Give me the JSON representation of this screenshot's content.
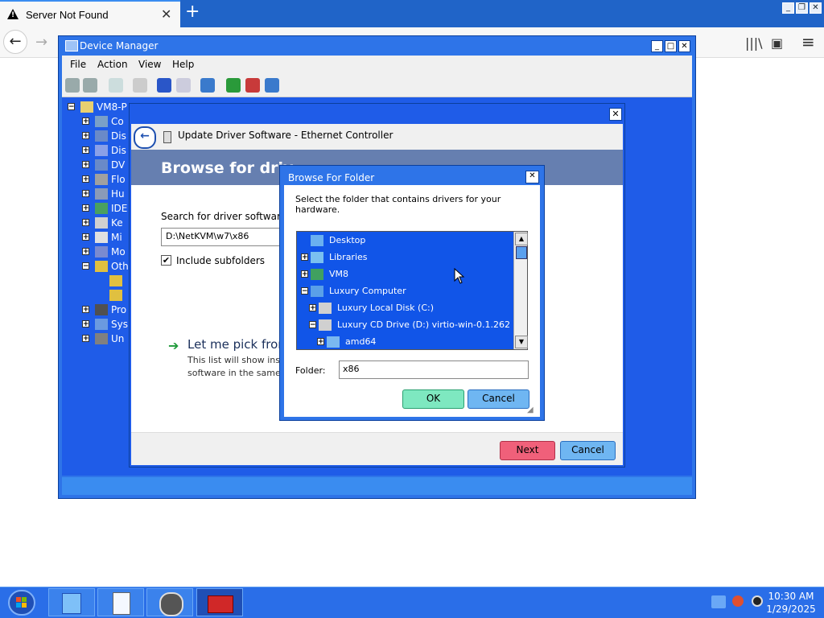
{
  "browser": {
    "tab_title": "Server Not Found",
    "tab_close": "✕",
    "new_tab": "+",
    "back": "←",
    "forward": "→",
    "library_icon": "|||\\",
    "sidebar_icon": "▣",
    "menu_icon": "≡",
    "win_min": "_",
    "win_max": "❐",
    "win_close": "✕"
  },
  "device_manager": {
    "title": "Device Manager",
    "menu": [
      "File",
      "Action",
      "View",
      "Help"
    ],
    "tree": [
      {
        "expander": "−",
        "label": "VM8-P",
        "level": 0
      },
      {
        "expander": "+",
        "label": "Co",
        "level": 1
      },
      {
        "expander": "+",
        "label": "Dis",
        "level": 1
      },
      {
        "expander": "+",
        "label": "Dis",
        "level": 1
      },
      {
        "expander": "+",
        "label": "DV",
        "level": 1
      },
      {
        "expander": "+",
        "label": "Flo",
        "level": 1
      },
      {
        "expander": "+",
        "label": "Hu",
        "level": 1
      },
      {
        "expander": "+",
        "label": "IDE",
        "level": 1
      },
      {
        "expander": "+",
        "label": "Ke",
        "level": 1
      },
      {
        "expander": "+",
        "label": "Mi",
        "level": 1
      },
      {
        "expander": "+",
        "label": "Mo",
        "level": 1
      },
      {
        "expander": "−",
        "label": "Oth",
        "level": 1
      },
      {
        "expander": "",
        "label": "",
        "level": 2
      },
      {
        "expander": "",
        "label": "",
        "level": 2
      },
      {
        "expander": "+",
        "label": "Pro",
        "level": 1
      },
      {
        "expander": "+",
        "label": "Sys",
        "level": 1
      },
      {
        "expander": "+",
        "label": "Un",
        "level": 1
      }
    ]
  },
  "wizard": {
    "title": "Update Driver Software - Ethernet Controller",
    "banner": "Browse for driv",
    "search_label": "Search for driver software in",
    "path_value": "D:\\NetKVM\\w7\\x86",
    "include_subfolders": "Include subfolders",
    "pick_heading": "Let me pick from",
    "pick_desc_1": "This list will show inst",
    "pick_desc_2": "software in the same c",
    "next": "Next",
    "cancel": "Cancel",
    "close": "✕"
  },
  "browse_folder": {
    "title": "Browse For Folder",
    "instruction": "Select the folder that contains drivers for your hardware.",
    "tree": [
      {
        "expander": "",
        "label": "Desktop"
      },
      {
        "expander": "+",
        "label": "Libraries"
      },
      {
        "expander": "+",
        "label": "VM8"
      },
      {
        "expander": "−",
        "label": "Luxury Computer"
      },
      {
        "expander": "+",
        "label": "Luxury Local Disk (C:)"
      },
      {
        "expander": "−",
        "label": "Luxury CD Drive (D:) virtio-win-0.1.262"
      },
      {
        "expander": "+",
        "label": "amd64"
      }
    ],
    "folder_label": "Folder:",
    "folder_value": "x86",
    "ok": "OK",
    "cancel": "Cancel",
    "close": "✕"
  },
  "taskbar": {
    "time": "10:30 AM",
    "date": "1/29/2025"
  },
  "colors": {
    "window_blue": "#2e74e8",
    "tree_blue": "#1f5ce8",
    "ok_green": "#7ee8c0",
    "cancel_blue": "#6fb6f2",
    "next_pink": "#f0607a"
  }
}
